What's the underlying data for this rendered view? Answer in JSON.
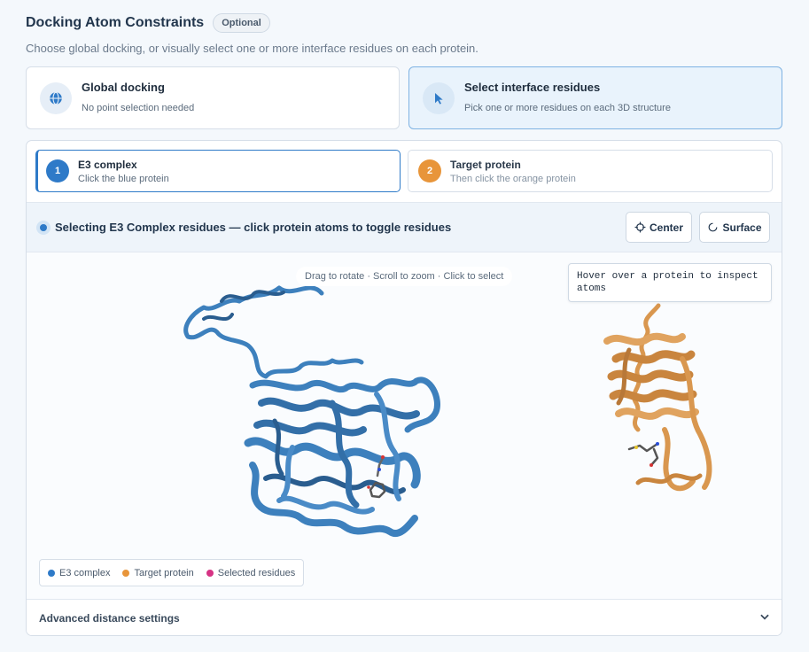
{
  "header": {
    "title": "Docking Atom Constraints",
    "badge": "Optional",
    "subtitle": "Choose global docking, or visually select one or more interface residues on each protein."
  },
  "modes": [
    {
      "title": "Global docking",
      "desc": "No point selection needed",
      "icon": "globe-icon",
      "selected": false
    },
    {
      "title": "Select interface residues",
      "desc": "Pick one or more residues on each 3D structure",
      "icon": "cursor-icon",
      "selected": true
    }
  ],
  "steps": [
    {
      "num": "1",
      "title": "E3 complex",
      "desc": "Click the blue protein",
      "color": "#2e7ac8",
      "active": true
    },
    {
      "num": "2",
      "title": "Target protein",
      "desc": "Then click the orange protein",
      "color": "#e8953a",
      "active": false
    }
  ],
  "status": {
    "text": "Selecting E3 Complex residues — click protein atoms to toggle residues",
    "center_label": "Center",
    "surface_label": "Surface"
  },
  "viewer": {
    "hint": "Drag to rotate · Scroll to zoom · Click to select",
    "inspect_text": "Hover over a protein to inspect atoms"
  },
  "legend": [
    {
      "label": "E3 complex",
      "color": "#2e7ac8"
    },
    {
      "label": "Target protein",
      "color": "#e8953a"
    },
    {
      "label": "Selected residues",
      "color": "#d63384"
    }
  ],
  "advanced": {
    "label": "Advanced distance settings"
  },
  "colors": {
    "accent": "#2e7ac8",
    "e3_protein": "#3d80bd",
    "target_protein": "#d9974f"
  }
}
